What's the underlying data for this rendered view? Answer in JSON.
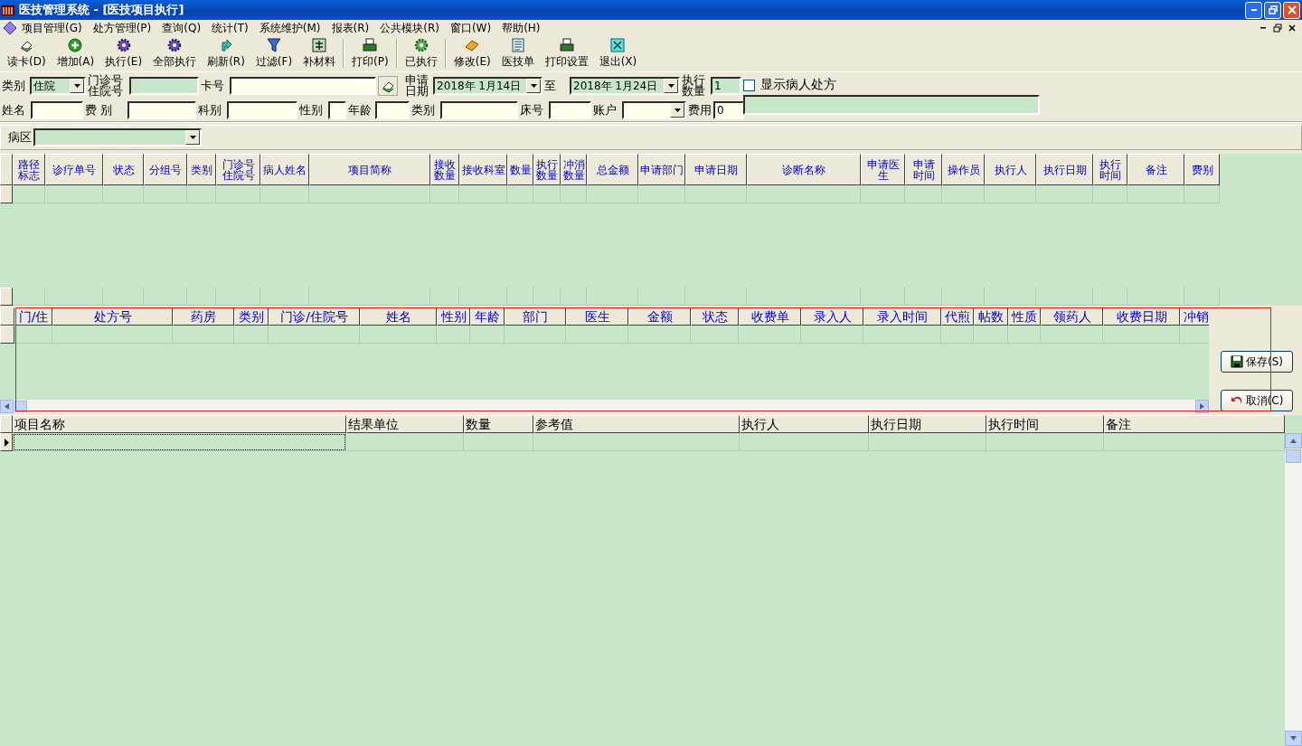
{
  "window": {
    "title": "医技管理系统 - [医技项目执行]"
  },
  "menu": [
    "项目管理(G)",
    "处方管理(P)",
    "查询(Q)",
    "统计(T)",
    "系统维护(M)",
    "报表(R)",
    "公共模块(R)",
    "窗口(W)",
    "帮助(H)"
  ],
  "toolbar": [
    {
      "label": "读卡(D)"
    },
    {
      "label": "增加(A)"
    },
    {
      "label": "执行(E)"
    },
    {
      "label": "全部执行"
    },
    {
      "label": "刷新(R)"
    },
    {
      "label": "过滤(F)"
    },
    {
      "label": "补材料"
    },
    {
      "label": "打印(P)"
    },
    {
      "label": "已执行"
    },
    {
      "label": "修改(E)"
    },
    {
      "label": "医技单"
    },
    {
      "label": "打印设置"
    },
    {
      "label": "退出(X)"
    }
  ],
  "form": {
    "row_1": [
      {
        "kind": "select",
        "label": "类别",
        "value": "住院",
        "readonly": true
      },
      {
        "kind": "text",
        "label": "门诊号住院号",
        "readonly": true
      },
      {
        "kind": "text",
        "label": "卡号",
        "readonly": false
      },
      {
        "kind": "card_button"
      },
      {
        "kind": "date",
        "label": "申请日期",
        "value": "2018年 1月14日",
        "readonly": true
      },
      {
        "kind": "date",
        "label": "至",
        "value": "2018年 1月24日",
        "readonly": true
      },
      {
        "kind": "text",
        "label": "执行数量",
        "value": "1",
        "readonly": true
      }
    ],
    "row_2": [
      {
        "kind": "text",
        "label": "姓名",
        "readonly": false
      },
      {
        "kind": "text",
        "label": "费 别",
        "readonly": false
      },
      {
        "kind": "text",
        "label": "科别",
        "readonly": false
      },
      {
        "kind": "text",
        "label": "性别",
        "readonly": false
      },
      {
        "kind": "text",
        "label": "年龄",
        "readonly": false
      },
      {
        "kind": "text",
        "label": "类别",
        "readonly": false
      },
      {
        "kind": "text",
        "label": "床号",
        "readonly": false
      },
      {
        "kind": "select",
        "label": "账户",
        "readonly": false
      },
      {
        "kind": "text",
        "label": "费用",
        "value": "0",
        "readonly": false
      }
    ],
    "show_prescription": {
      "label": "显示病人处方",
      "checked": false
    },
    "prescription_field": {
      "readonly": true
    },
    "ward": {
      "kind": "select",
      "label": "病区",
      "readonly": true
    }
  },
  "items_table": {
    "columns": [
      "路径标志",
      "诊疗单号",
      "状态",
      "分组号",
      "类别",
      "门诊号住院号",
      "病人姓名",
      "项目简称",
      "接收数量",
      "接收科室",
      "数量",
      "执行数量",
      "冲消数量",
      "总金额",
      "申请部门",
      "申请日期",
      "诊断名称",
      "申请医生",
      "申请时间",
      "操作员",
      "执行人",
      "执行日期",
      "执行时间",
      "备注",
      "费别"
    ]
  },
  "prescription_table": {
    "columns": [
      "门/住",
      "处方号",
      "药房",
      "类别",
      "门诊/住院号",
      "姓名",
      "性别",
      "年龄",
      "部门",
      "医生",
      "金额",
      "状态",
      "收费单",
      "录入人",
      "录入时间",
      "代煎",
      "帖数",
      "性质",
      "领药人",
      "收费日期",
      "冲销"
    ]
  },
  "buttons": [
    {
      "label": "保存(S)"
    },
    {
      "label": "取消(C)"
    }
  ],
  "result_table": {
    "columns": [
      "项目名称",
      "结果单位",
      "数量",
      "参考值",
      "执行人",
      "执行日期",
      "执行时间",
      "备注"
    ]
  }
}
